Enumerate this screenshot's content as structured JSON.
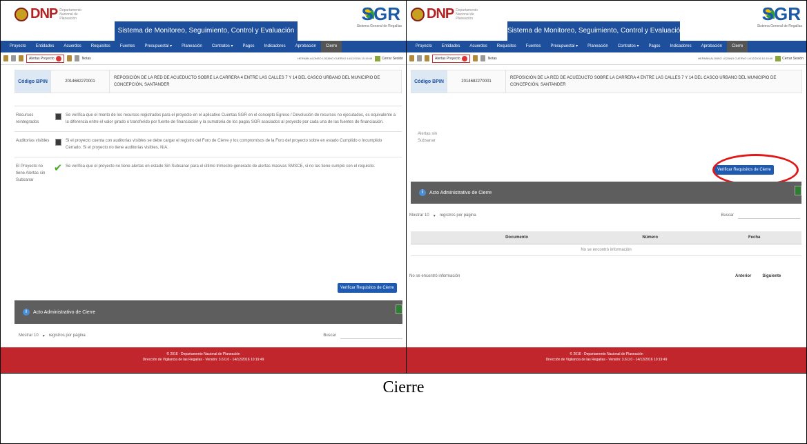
{
  "header": {
    "dnp_logo_text": "DNP",
    "dnp_logo_sub": "Departamento Nacional de Planeación",
    "sgr_logo_text": "SGR",
    "sgr_logo_sub": "Sistema General de Regalías",
    "system_title": "Sistema de Monitoreo, Seguimiento, Control y Evaluación"
  },
  "nav": {
    "items": [
      "Proyecto",
      "Entidades",
      "Acuerdos",
      "Requisitos",
      "Fuentes",
      "Presupuestal ▾",
      "Planeación",
      "Contratos ▾",
      "Pagos",
      "Indicadores",
      "Aprobación",
      "Cierre"
    ],
    "active": "Cierre"
  },
  "toolbar": {
    "alerts_label": "Alertas Proyecto",
    "notes_label": "Notas",
    "user_info": "HERNÁN ALONSO LOZANO CUERVO 14/12/2016 10:19:49",
    "logout_label": "Cerrar Sesión"
  },
  "project": {
    "bpin_label": "Código BPIN",
    "bpin_code": "2014682270001",
    "name": "REPOSICIÓN DE LA RED DE ACUEDUCTO SOBRE LA CARRERA 4 ENTRE LAS CALLES 7 Y 14 DEL CASCO URBANO DEL MUNICIPIO DE CONCEPCIÓN, SANTANDER"
  },
  "requirements": [
    {
      "label": "Recursos reintegrados",
      "icon": "document-icon",
      "text": "Se verifica que el monto de los recursos registrados para el proyecto en el aplicativo Cuentas SGR en el concepto Egreso / Devolución de recursos no ejecutados, es equivalente a la diferencia entre el valor girado o transferido por fuente de financiación y la sumatoria de los pagos SGR asociados al proyecto por cada una de las fuentes de financiación."
    },
    {
      "label": "Auditorías visibles",
      "icon": "document-icon",
      "text": "Si el proyecto cuenta con auditorías visibles se debe cargar el registro del Foro de Cierre y los compromisos de la Foro del proyecto sobre en estado Cumplido o Incumplido Cerrado. Si el proyecto no tiene auditorías visibles, N/A."
    },
    {
      "label": "El Proyecto no tiene Alertas sin Subsanar",
      "icon": "check-icon",
      "text": "Se verifica que el proyecto no tiene alertas en estado Sin Subsanar para el último trimestre generado de alertas masivas SMSCE, si no las tiene cumple con el requisito."
    }
  ],
  "right_panel_notes": "Alertas sin Subsanar",
  "verify_button_label": "Verificar Requisitos de Cierre",
  "acto_section": {
    "title": "Acto Administrativo de Cierre",
    "show_label": "Mostrar 10",
    "per_page_label": "registros por página",
    "search_label": "Buscar",
    "table_headers": [
      "",
      "Documento",
      "Número",
      "Fecha"
    ],
    "empty_row": "No se encontró información",
    "status_text": "No se encontró información",
    "pager_prev": "Anterior",
    "pager_next": "Siguiente"
  },
  "footer": {
    "line1": "© 2016 - Departamento Nacional de Planeación",
    "line2": "Dirección de Vigilancia de las Regalías - Versión: 3.6.0.0 - 14/12/2016 10:19:49"
  },
  "caption": "Cierre",
  "colors": {
    "nav_blue": "#1d4f9c",
    "section_gray": "#5e5e5e",
    "footer_red": "#c0262c",
    "highlight_red": "#e01818",
    "check_green": "#4caa2a"
  }
}
